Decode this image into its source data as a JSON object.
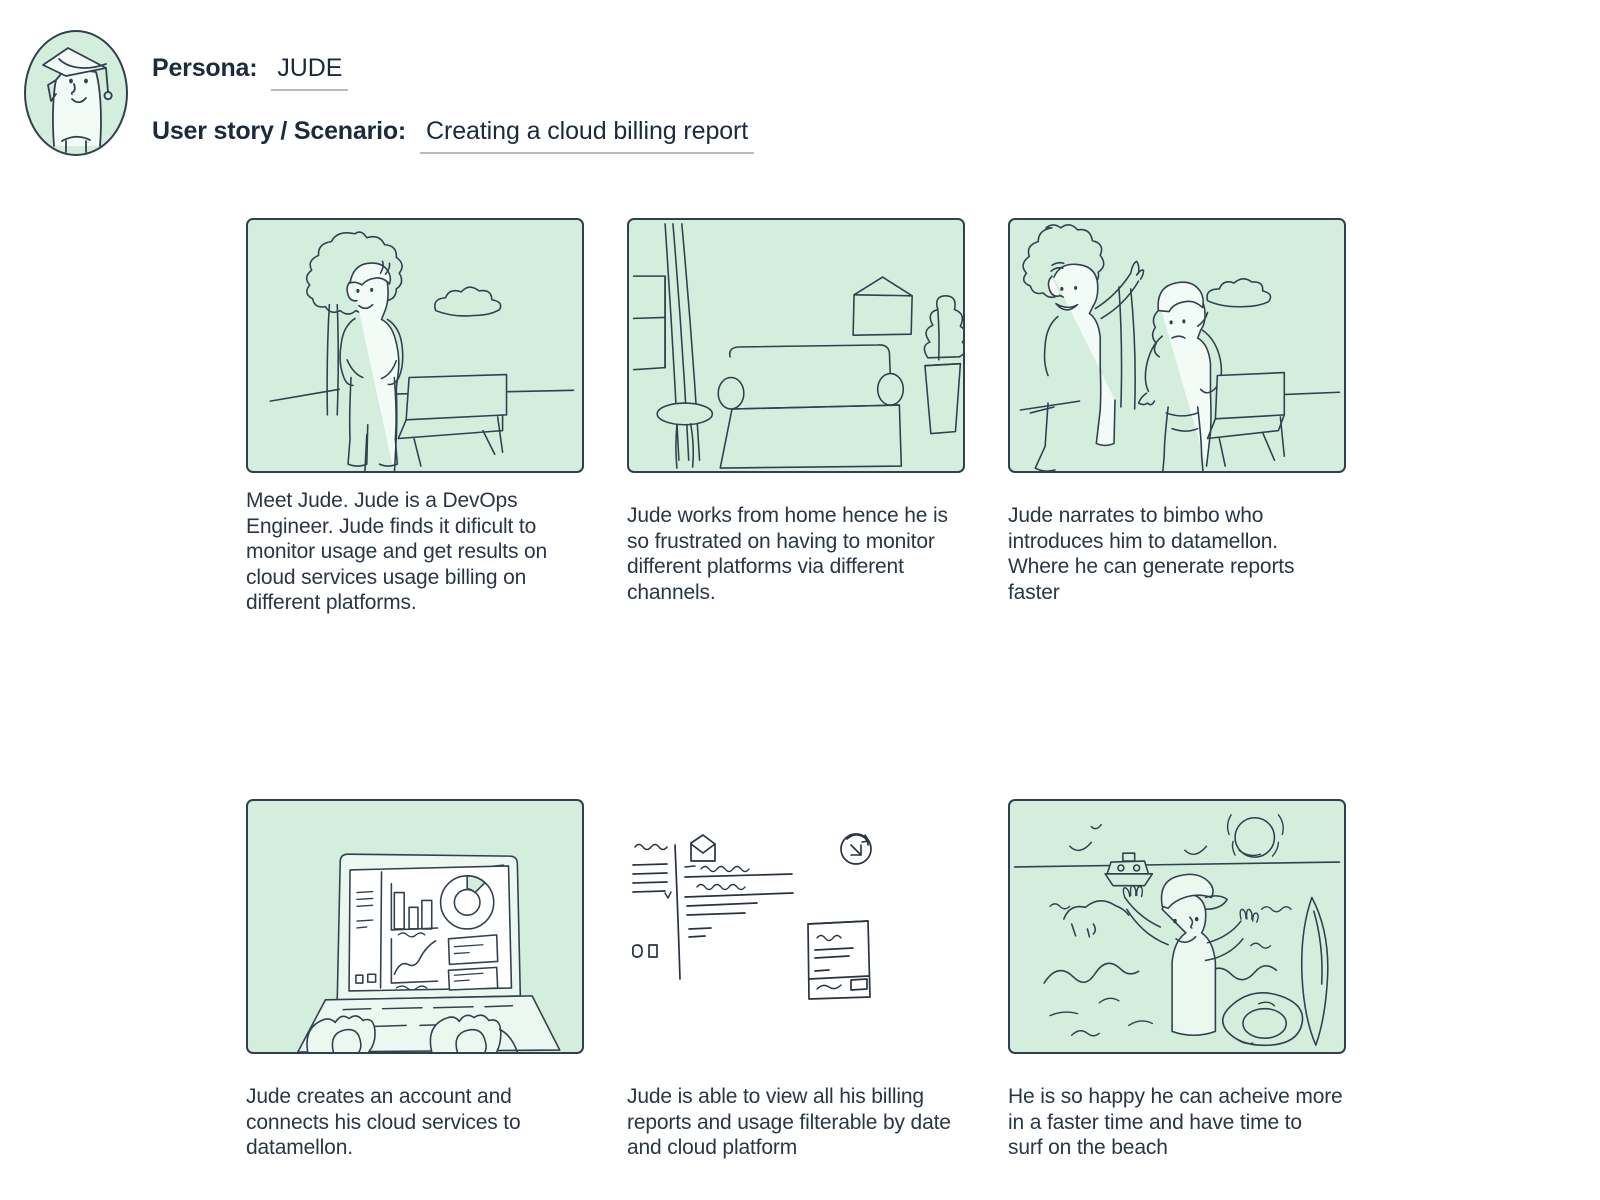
{
  "header": {
    "persona_label": "Persona:",
    "persona_value": "JUDE",
    "scenario_label": "User story / Scenario:",
    "scenario_value": "Creating a cloud billing report",
    "avatar_icon": "graduate-character-avatar"
  },
  "colors": {
    "panel_fill": "#d3eedd",
    "ink": "#31404f",
    "text": "#2b3645",
    "underline": "#b8bcc2",
    "page_background": "#ffffff"
  },
  "panels": [
    {
      "id": "panel-1",
      "scene": "person-standing-outdoors-with-tree-cloud-and-bench",
      "caption": "Meet Jude. Jude is a DevOps\nEngineer. Jude finds it dificult to\nmonitor usage and get results on\ncloud services usage billing on\ndifferent platforms."
    },
    {
      "id": "panel-2",
      "scene": "living-room-with-sofa-window-curtain-picture-frame-and-plant",
      "caption": "Jude works from home hence he is\nso frustrated on having to monitor\ndifferent platforms via different\nchannels."
    },
    {
      "id": "panel-3",
      "scene": "two-people-talking-outdoors-one-pointing-up",
      "caption": "Jude narrates to bimbo who\nintroduces him to datamellon.\nWhere he can generate reports\nfaster"
    },
    {
      "id": "panel-4",
      "scene": "hands-typing-on-laptop-showing-analytics-dashboard",
      "caption": "Jude creates an account and\nconnects his cloud services to\ndatamellon."
    },
    {
      "id": "panel-5",
      "scene": "documents-email-and-report-line-art-no-background",
      "caption": "Jude is able to view all his billing\nreports and usage filterable by date\nand cloud platform"
    },
    {
      "id": "panel-6",
      "scene": "person-in-cap-waving-at-beach-with-boat-sun-surfboard-and-float",
      "caption": "He is so happy he can acheive more\nin a faster time and have time to\nsurf on the beach"
    }
  ]
}
